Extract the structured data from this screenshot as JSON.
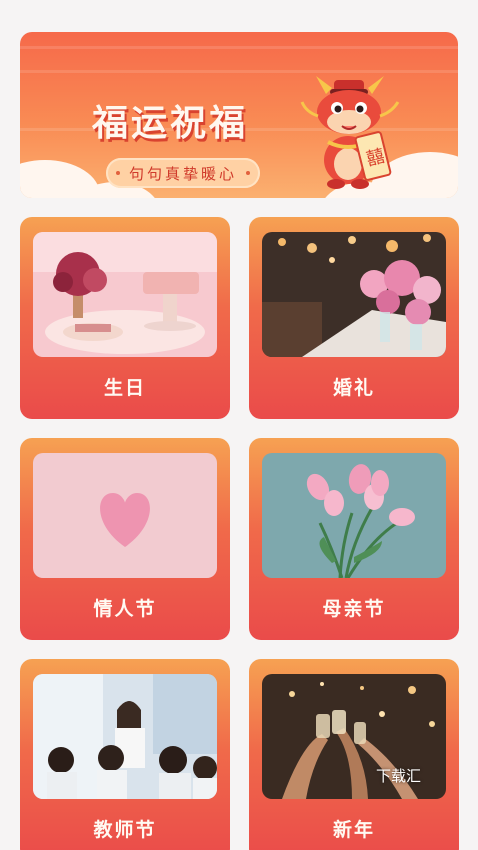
{
  "banner": {
    "title": "福运祝福",
    "subtitle": "句句真挚暖心",
    "mascot_icon": "dragon-mascot-icon",
    "mascot_scroll_text": "囍"
  },
  "categories": [
    {
      "label": "生日",
      "image": "birthday-cake-flowers"
    },
    {
      "label": "婚礼",
      "image": "wedding-table-flowers"
    },
    {
      "label": "情人节",
      "image": "pink-heart"
    },
    {
      "label": "母亲节",
      "image": "pink-tulips"
    },
    {
      "label": "教师节",
      "image": "teacher-with-children"
    },
    {
      "label": "新年",
      "image": "champagne-toast"
    }
  ],
  "watermark": "下载汇",
  "colors": {
    "background": "#f6f4f4",
    "banner_top": "#f6694a",
    "card_top": "#f6a152",
    "card_bottom": "#ea4b4a",
    "label_text": "#fffaf3"
  }
}
